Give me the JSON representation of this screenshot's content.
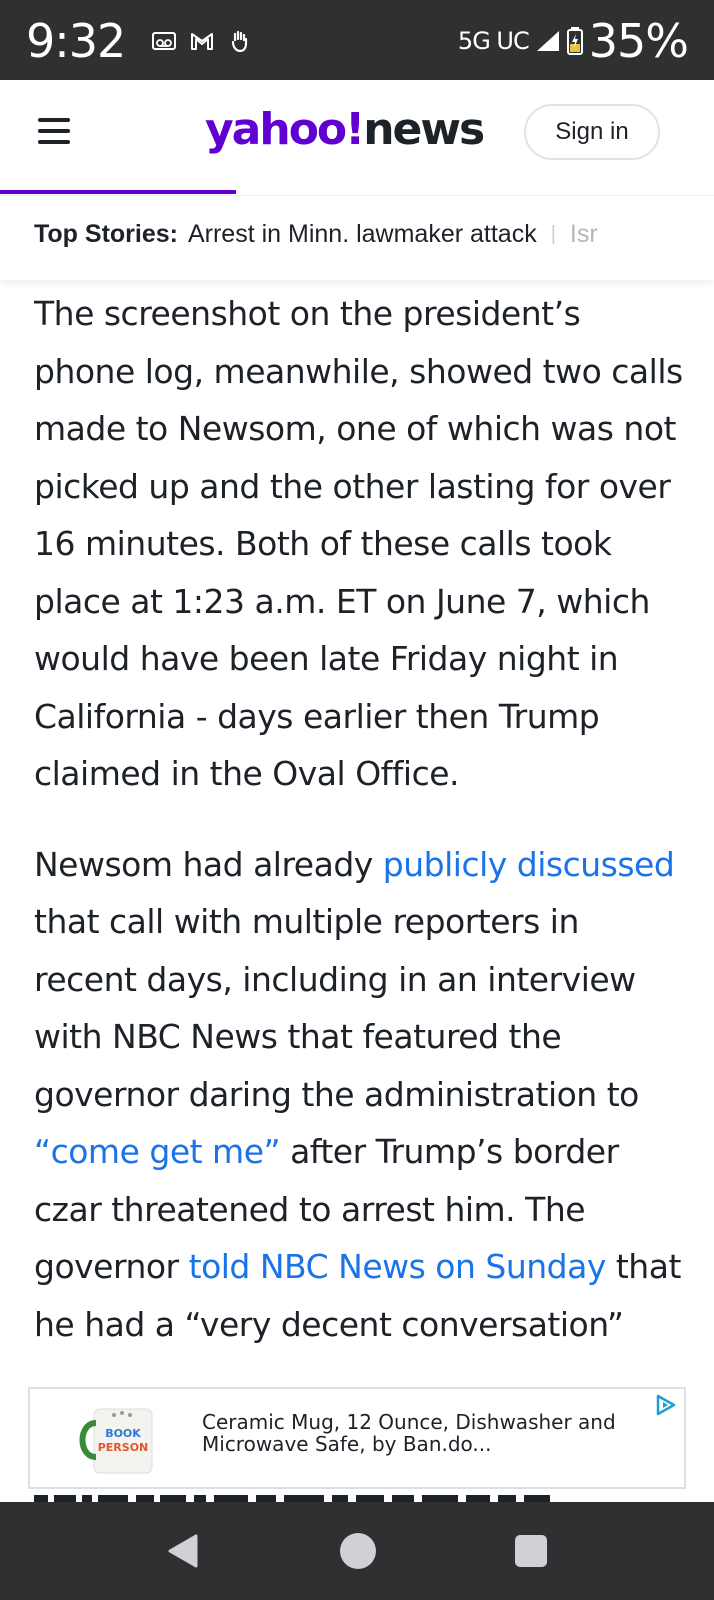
{
  "status_bar": {
    "time": "9:32",
    "network": "5G UC",
    "battery": "35%",
    "icons": [
      "voicemail-icon",
      "gmail-icon",
      "hand-icon",
      "signal-icon",
      "battery-icon"
    ]
  },
  "header": {
    "logo_yahoo": "yahoo!",
    "logo_news": "news",
    "sign_in": "Sign in",
    "read_progress": 0.33,
    "accent_color": "#6001d2"
  },
  "top_stories": {
    "label": "Top Stories:",
    "items": [
      "Arrest in Minn. lawmaker attack",
      "Isr"
    ]
  },
  "article": {
    "p1": "The screenshot on the president’s phone log, meanwhile, showed two calls made to Newsom, one of which was not picked up and the other lasting for over 16 minutes. Both of these calls took place at 1:23 a.m. ET on June 7, which would have been late Friday night in California - days earlier then Trump claimed in the Oval Office.",
    "p2": {
      "t1": "Newsom had already ",
      "link1": "publicly discussed",
      "t2": " that call with multiple reporters in recent days, including in an interview with NBC News that featured the governor daring the administration to ",
      "link2": "“come get me”",
      "t3": " after Trump’s border czar threatened to arrest him. The governor ",
      "link3": "told NBC News on Sunday",
      "t4": " that he had a “very decent conversation” with Trump late Friday"
    },
    "link_color": "#1a73e8"
  },
  "ad": {
    "text": "Ceramic Mug, 12 Ounce, Dishwasher and Microwave Safe, by Ban.do...",
    "thumb_text_1": "BOOK",
    "thumb_text_2": "PERSON",
    "icon": "adchoices-icon"
  },
  "nav_bar": {
    "icons": [
      "back-icon",
      "home-icon",
      "recents-icon"
    ]
  }
}
